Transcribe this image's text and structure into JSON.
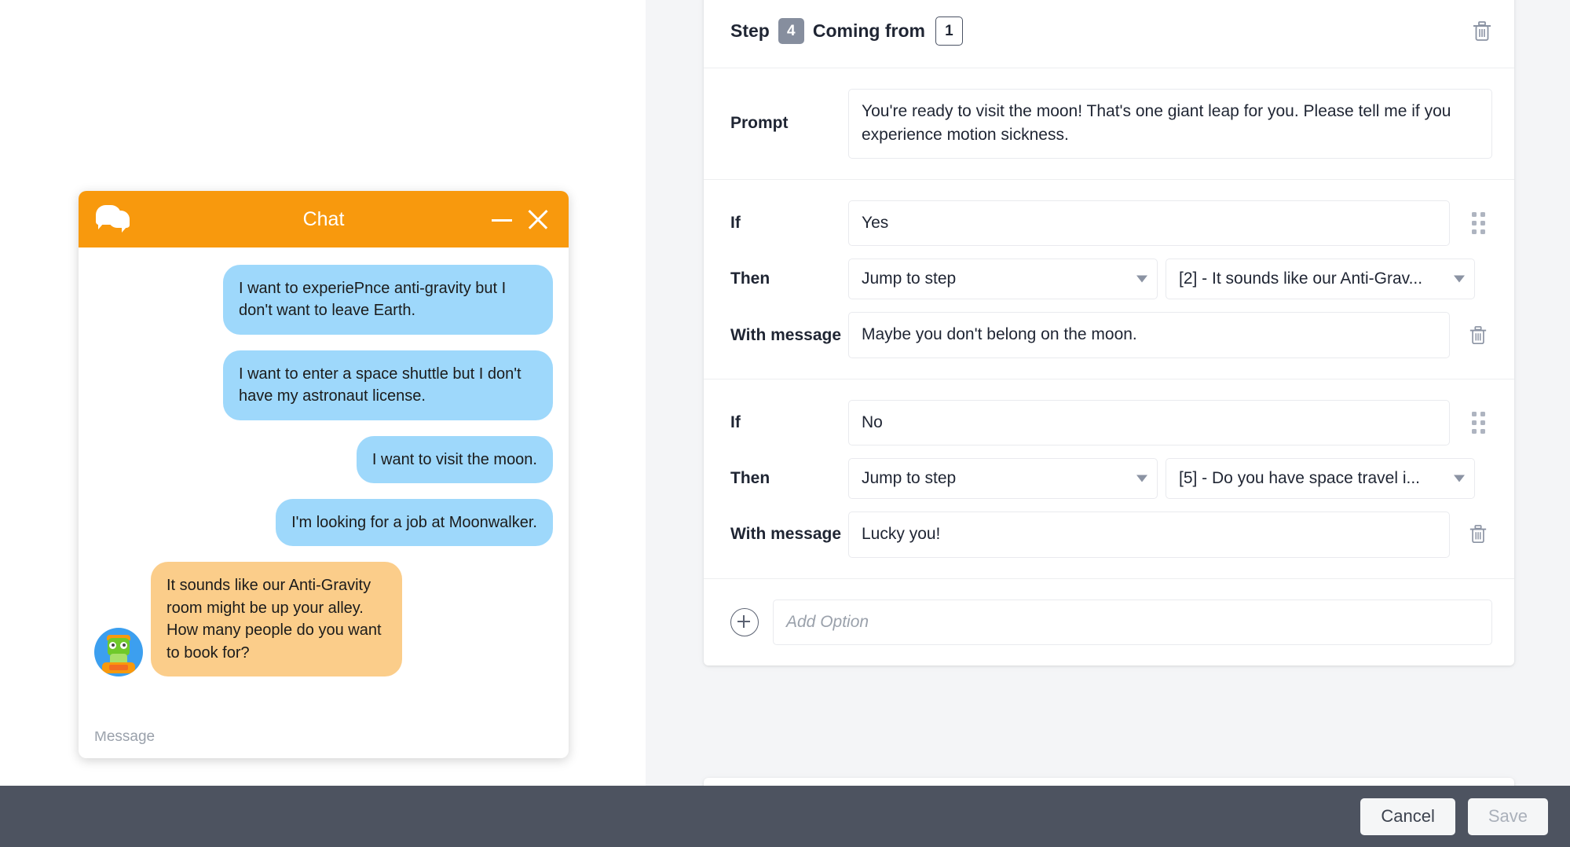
{
  "chat": {
    "title": "Chat",
    "icon": "chat-bubbles-icon",
    "minimize_label": "—",
    "close_label": "✕",
    "messages": [
      {
        "from": "user",
        "text": "I want to experiePnce anti-gravity but I don't want to leave Earth."
      },
      {
        "from": "user",
        "text": "I want to enter a space shuttle but I don't have my astronaut license."
      },
      {
        "from": "user",
        "text": "I want to visit the moon."
      },
      {
        "from": "user",
        "text": "I'm looking for a job at Moonwalker."
      },
      {
        "from": "bot",
        "text": "It sounds like our Anti-Gravity room might be up your alley. How many people do you want to book for?"
      }
    ],
    "footer_peek": "Message"
  },
  "step_card": {
    "step_label": "Step",
    "step_number": "4",
    "coming_from_label": "Coming from",
    "coming_from_value": "1",
    "delete_icon": "trash-icon",
    "prompt": {
      "label": "Prompt",
      "value": "You're ready to visit the moon! That's one giant leap for you. Please tell me if you experience motion sickness."
    },
    "options": [
      {
        "if_label": "If",
        "if_value": "Yes",
        "then_label": "Then",
        "action": "Jump to step",
        "target": "[2] - It sounds like our Anti-Grav...",
        "message_label": "With message",
        "message_value": "Maybe you don't belong on the moon.",
        "drag_icon": "drag-handle-icon",
        "delete_icon": "trash-icon"
      },
      {
        "if_label": "If",
        "if_value": "No",
        "then_label": "Then",
        "action": "Jump to step",
        "target": "[5] - Do you have space travel i...",
        "message_label": "With message",
        "message_value": "Lucky you!",
        "drag_icon": "drag-handle-icon",
        "delete_icon": "trash-icon"
      }
    ],
    "add_option": {
      "icon": "plus-circle-icon",
      "placeholder": "Add Option"
    }
  },
  "footer": {
    "cancel_label": "Cancel",
    "save_label": "Save"
  },
  "colors": {
    "accent_orange": "#f8990d",
    "user_bubble": "#9ed8fb",
    "bot_bubble": "#fbcd8a",
    "panel_bg": "#f4f5f7",
    "footer_bg": "#4d5360",
    "badge_gray": "#868e9e"
  }
}
